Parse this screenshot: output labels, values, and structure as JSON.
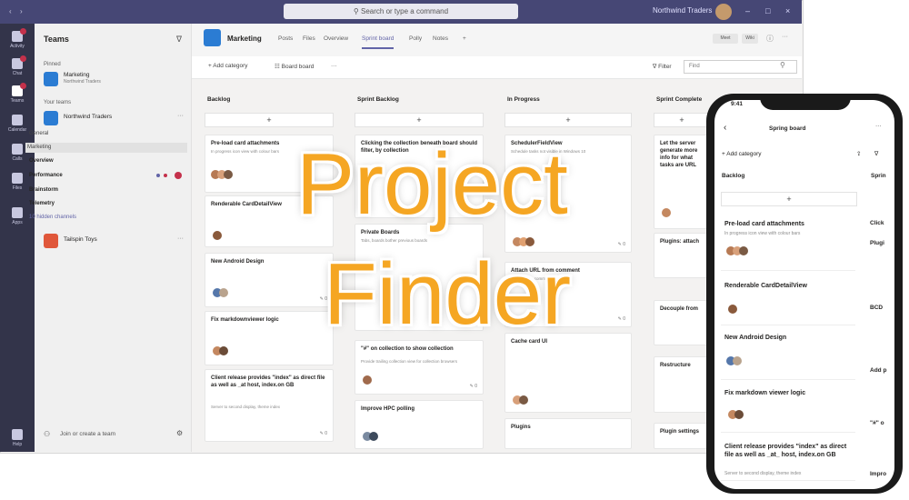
{
  "overlay": {
    "line1": "Project",
    "line2": "Finder"
  },
  "titlebar": {
    "search_placeholder": "Search or type a command",
    "user": "Northwind Traders"
  },
  "rail": {
    "items": [
      "Activity",
      "Chat",
      "Teams",
      "Calendar",
      "Calls",
      "Files",
      "Apps",
      "Help"
    ]
  },
  "teams_pane": {
    "title": "Teams",
    "pinned_label": "Pinned",
    "your_teams_label": "Your teams",
    "pinned": {
      "name": "Marketing",
      "sub": "Northwind Traders"
    },
    "team": "Northwind Traders",
    "channels": [
      "General",
      "Marketing",
      "Overview",
      "Performance",
      "Brainstorm",
      "Telemetry",
      "10 hidden channels"
    ],
    "team2": "Tailspin Toys",
    "join": "Join or create a team"
  },
  "channel": {
    "name": "Marketing",
    "tabs": [
      "Posts",
      "Files",
      "Overview",
      "Sprint board",
      "Polly",
      "Notes",
      "+"
    ],
    "active_tab": "Sprint board",
    "btns": [
      "Meet",
      "Wiki"
    ]
  },
  "toolbar": {
    "add_category": "Add category",
    "board": "Board board",
    "filter": "Filter",
    "filter_placeholder": "Find"
  },
  "board": {
    "columns": [
      "Backlog",
      "Sprint Backlog",
      "In Progress",
      "Sprint Complete"
    ],
    "col1": [
      {
        "title": "Pre-load card attachments",
        "desc": "In progress icon view with colour bars"
      },
      {
        "title": "Renderable CardDetailView",
        "desc": ""
      },
      {
        "title": "New Android Design",
        "desc": ""
      },
      {
        "title": "Fix markdownviewer logic",
        "desc": ""
      },
      {
        "title": "Client release provides \"index\" as direct file as well as _at host, index.on GB",
        "desc": "Server to second display, theme index"
      }
    ],
    "col2": [
      {
        "title": "Clicking the collection beneath board should filter, by collection",
        "desc": ""
      },
      {
        "title": "Private Boards",
        "desc": "Tabs, boards bother previous boards"
      },
      {
        "title": "\"#\" on collection to show collection",
        "desc": "Provide trailing collection view for collection browsers"
      },
      {
        "title": "Improve HPC polling",
        "desc": ""
      }
    ],
    "col3": [
      {
        "title": "SchedulerFieldView",
        "desc": "Schedule tasks not visible in Windows 10"
      },
      {
        "title": "Attach URL from comment",
        "desc": "Upload from comment"
      },
      {
        "title": "Cache card UI",
        "desc": ""
      },
      {
        "title": "Plugins",
        "desc": ""
      }
    ],
    "col4": [
      {
        "title": "Let the server generate more info for what tasks are URL",
        "desc": ""
      },
      {
        "title": "Plugins: attach",
        "desc": ""
      },
      {
        "title": "Decouple from",
        "desc": ""
      },
      {
        "title": "Restructure",
        "desc": ""
      },
      {
        "title": "Plugin settings",
        "desc": ""
      }
    ]
  },
  "phone": {
    "title": "Spring board",
    "add_category": "Add category",
    "col": "Backlog",
    "col2": "Sprin",
    "cards": [
      {
        "title": "Pre-load card attachments",
        "desc": "In progress icon view with colour bars"
      },
      {
        "title": "Renderable CardDetailView",
        "desc": ""
      },
      {
        "title": "New Android Design",
        "desc": ""
      },
      {
        "title": "Fix markdown viewer logic",
        "desc": ""
      },
      {
        "title": "Client release provides \"index\" as direct file as well as _at_ host, index.on GB",
        "desc": "Server to second display, theme index"
      }
    ],
    "side": [
      "Click",
      "Plugi",
      "BCD",
      "Add p",
      "\"#\" o",
      "Impro"
    ]
  },
  "colors": {
    "brand": "#464775",
    "accent": "#6264a7",
    "overlay": "#f5a623"
  }
}
